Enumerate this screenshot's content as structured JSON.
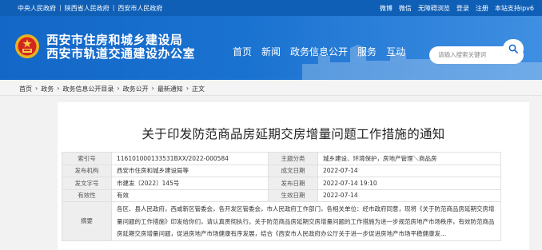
{
  "topbar": {
    "links_left": [
      "中央人民政府",
      "陕西省人民政府",
      "西安市人民政府"
    ],
    "separator": "|",
    "links_right": [
      "微博",
      "微信",
      "无障碍浏览",
      "登录",
      "注册",
      "本站支持ipv6"
    ]
  },
  "header": {
    "title_line1": "西安市住房和城乡建设局",
    "title_line2": "西安市轨道交通建设办公室",
    "nav": [
      "首页",
      "新闻",
      "政务信息公开",
      "服务",
      "互动"
    ],
    "search_placeholder": "请输入搜索关键词",
    "accent_color": "#1367c7"
  },
  "breadcrumb": {
    "items": [
      "首页",
      "政务",
      "政务信息公开目录",
      "政务公开",
      "最新通知",
      "正文"
    ],
    "separator": "›"
  },
  "article": {
    "title": "关于印发防范商品房延期交房增量问题工作措施的通知",
    "meta": {
      "index_label": "索引号",
      "index_value": "116101000133531BXX/2022-000584",
      "category_label": "主题分类",
      "category_value": "城乡建设、环境保护，房地产管理＼商品房",
      "org_label": "发布机构",
      "org_value": "西安市住房和城乡建设局等",
      "created_label": "成文日期",
      "created_value": "2022-07-14",
      "docno_label": "发文字号",
      "docno_value": "市建发〔2022〕145号",
      "published_label": "发布日期",
      "published_value": "2022-07-14 19:10",
      "validity_label": "有效性",
      "validity_value": "有效",
      "effective_label": "生效日期",
      "effective_value": "2022-07-14",
      "summary_label": "摘要",
      "summary_value": "各区、县人民政府，西咸新区管委会，各开发区管委会，市人民政府工作部门，各相关单位：经市政府同意，现将《关于防范商品房延期交房增量问题的工作措施》印发给你们，请认真贯彻执行。关于防范商品房延期交房增量问题的工作措施为进一步规范房地产市场秩序，有效防范商品房延期交房增量问题，促进房地产市场健康有序发展，结合《西安市人民政府办公厅关于进一步促进房地产市场平稳健康发..."
    }
  }
}
